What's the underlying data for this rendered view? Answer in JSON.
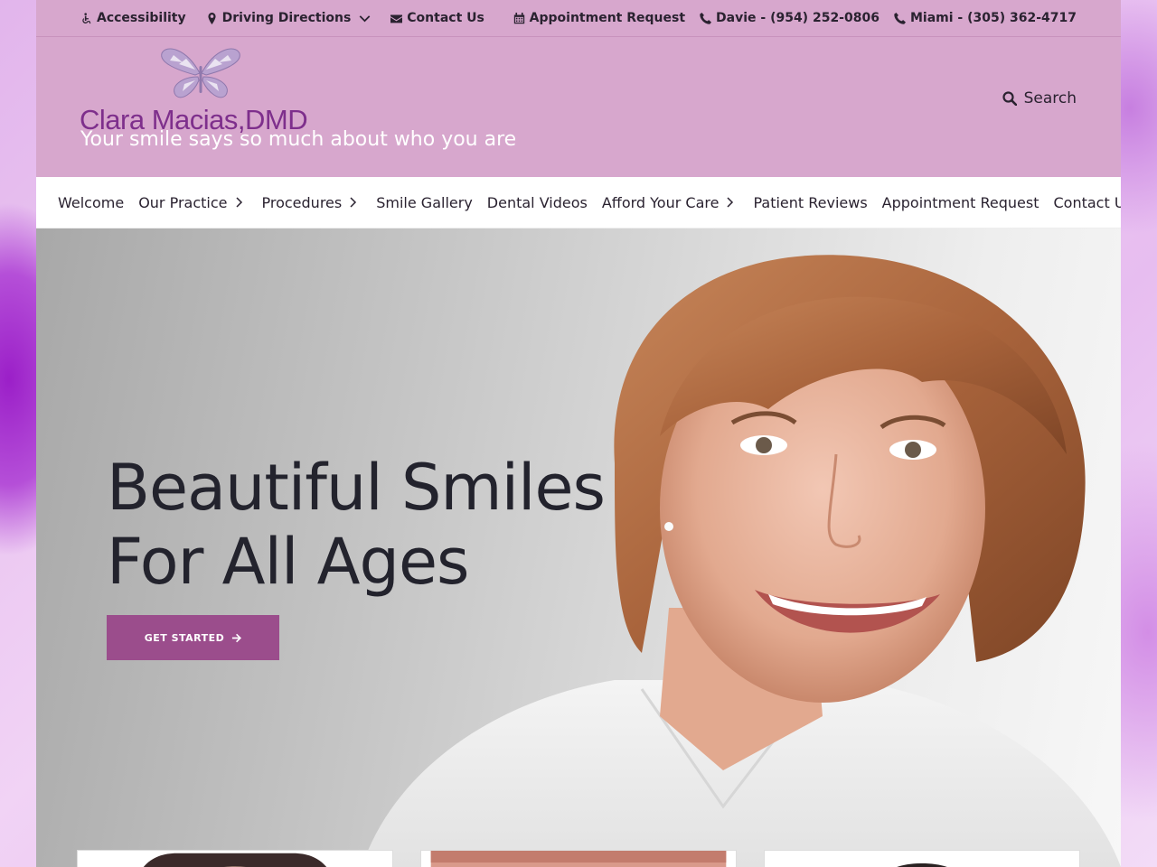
{
  "utility": {
    "accessibility": "Accessibility",
    "directions": "Driving Directions",
    "contact": "Contact Us",
    "appointment": "Appointment Request",
    "phone_davie": "Davie - (954) 252-0806",
    "phone_miami": "Miami - (305) 362-4717"
  },
  "brand": {
    "name": "Clara Macias",
    "suffix": "DMD",
    "tagline": "Your smile says so much about who you are"
  },
  "search": {
    "label": "Search"
  },
  "nav": {
    "items": [
      {
        "label": "Welcome"
      },
      {
        "label": "Our Practice"
      },
      {
        "label": "Procedures"
      },
      {
        "label": "Smile Gallery"
      },
      {
        "label": "Dental Videos"
      },
      {
        "label": "Afford Your Care"
      },
      {
        "label": "Patient Reviews"
      },
      {
        "label": "Appointment Request"
      },
      {
        "label": "Contact Us"
      }
    ]
  },
  "hero": {
    "line1": "Beautiful Smiles",
    "line2": "For All Ages",
    "cta": "GET STARTED"
  },
  "colors": {
    "header_bg": "#d7a7cd",
    "brand_purple": "#7e2f8c",
    "cta_bg": "#9b4d8c",
    "text_dark": "#23232d"
  },
  "icons": [
    "wheelchair-icon",
    "map-marker-icon",
    "envelope-icon",
    "calendar-icon",
    "phone-icon",
    "search-icon",
    "chevron-down-icon",
    "chevron-right-icon",
    "arrow-right-icon",
    "butterfly-logo-icon"
  ]
}
